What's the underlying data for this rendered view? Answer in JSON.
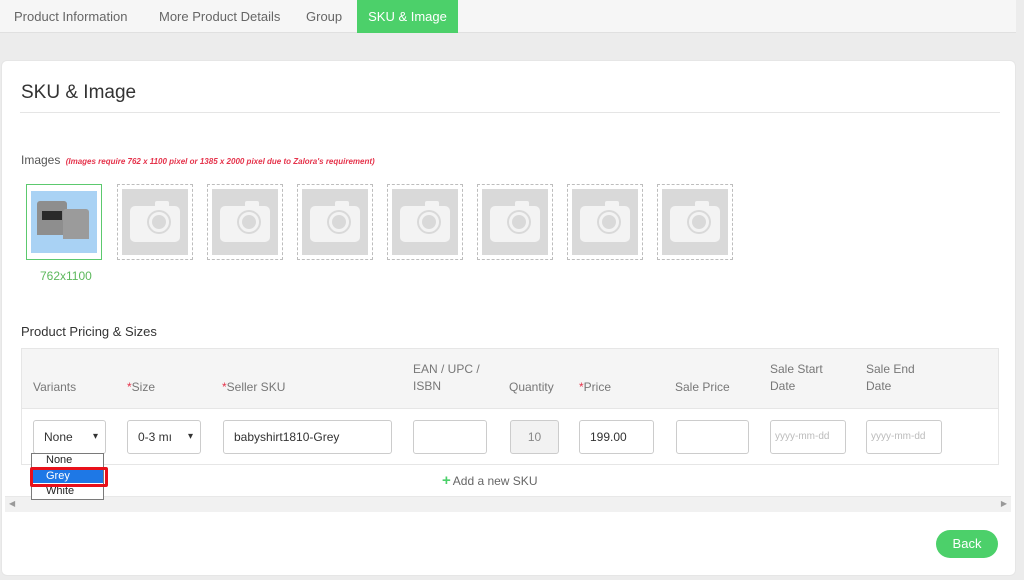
{
  "tabs": [
    {
      "label": "Product Information",
      "active": false
    },
    {
      "label": "More Product Details",
      "active": false
    },
    {
      "label": "Group",
      "active": false
    },
    {
      "label": "SKU & Image",
      "active": true
    }
  ],
  "colors": {
    "accent": "#4cd06a",
    "required": "#e5334b",
    "highlight": "#1e78e6",
    "annotation": "#e8101a"
  },
  "card": {
    "title": "SKU & Image"
  },
  "images": {
    "label": "Images",
    "note": "(Images require 762 x 1100 pixel or 1385 x 2000 pixel due to Zalora's requirement)",
    "first_size": "762x1100",
    "slot_icon": "camera-icon"
  },
  "pricing": {
    "label": "Product Pricing & Sizes",
    "headers": {
      "variants": "Variants",
      "size": "Size",
      "seller_sku": "Seller SKU",
      "ean_line1": "EAN / UPC /",
      "ean_line2": "ISBN",
      "quantity": "Quantity",
      "price": "Price",
      "sale_price": "Sale Price",
      "sale_start_line1": "Sale Start",
      "sale_start_line2": "Date",
      "sale_end_line1": "Sale End",
      "sale_end_line2": "Date"
    },
    "required_mark": "*",
    "row": {
      "variant": "None",
      "size": "0-3 mı",
      "seller_sku": "babyshirt1810-Grey",
      "ean": "",
      "quantity": "10",
      "price": "199.00",
      "sale_price": "",
      "sale_start_placeholder": "yyyy-mm-dd",
      "sale_end_placeholder": "yyyy-mm-dd"
    },
    "add_sku": "Add a new SKU",
    "add_icon": "+"
  },
  "variant_dropdown": {
    "options": [
      "None",
      "Grey",
      "White"
    ],
    "highlighted": "Grey"
  },
  "scroll": {
    "left": "◀",
    "right": "▶"
  },
  "back_button": "Back"
}
